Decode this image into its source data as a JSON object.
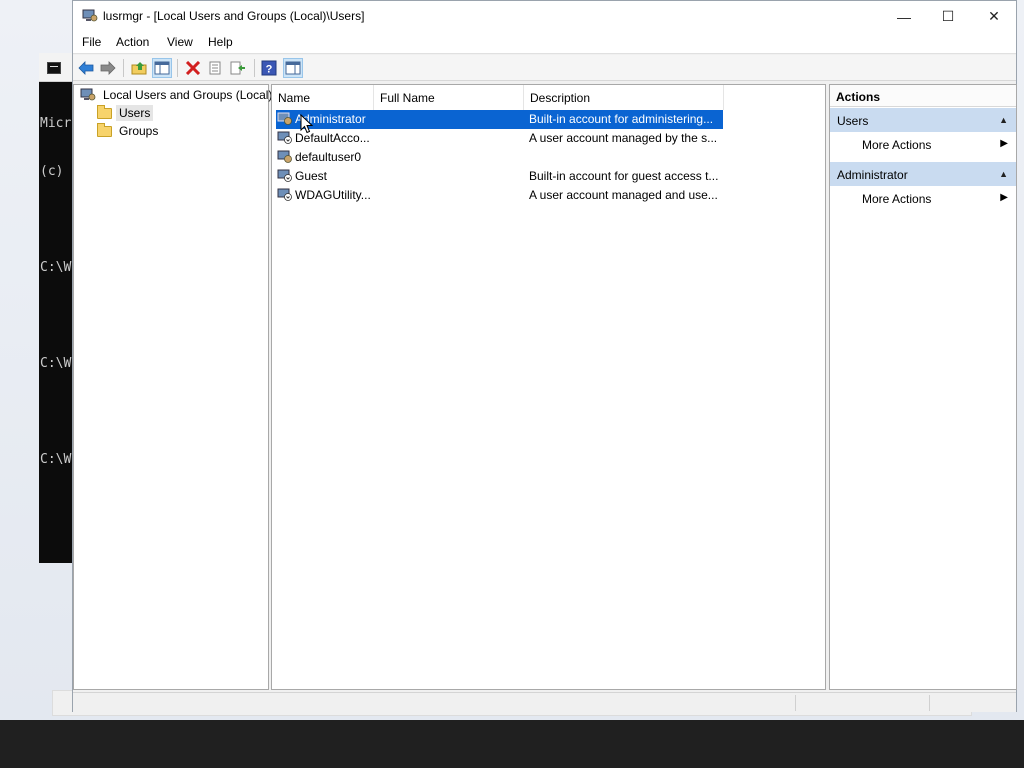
{
  "window": {
    "title": "lusrmgr - [Local Users and Groups (Local)\\Users]",
    "minimize_glyph": "—",
    "maximize_glyph": "☐",
    "close_glyph": "✕"
  },
  "menu": [
    "File",
    "Action",
    "View",
    "Help"
  ],
  "toolbar_icons": [
    "back-arrow-icon",
    "forward-arrow-icon",
    "up-folder-icon",
    "show-hide-tree-icon",
    "delete-icon",
    "properties-icon",
    "export-list-icon",
    "help-icon",
    "show-hide-action-pane-icon"
  ],
  "tree": {
    "root": "Local Users and Groups (Local)",
    "children": [
      {
        "label": "Users",
        "selected": true
      },
      {
        "label": "Groups",
        "selected": false
      }
    ]
  },
  "list": {
    "columns": [
      "Name",
      "Full Name",
      "Description"
    ],
    "rows": [
      {
        "name": "Administrator",
        "full_name": "",
        "description": "Built-in account for administering...",
        "selected": true
      },
      {
        "name": "DefaultAcco...",
        "full_name": "",
        "description": "A user account managed by the s...",
        "selected": false
      },
      {
        "name": "defaultuser0",
        "full_name": "",
        "description": "",
        "selected": false
      },
      {
        "name": "Guest",
        "full_name": "",
        "description": "Built-in account for guest access t...",
        "selected": false
      },
      {
        "name": "WDAGUtility...",
        "full_name": "",
        "description": "A user account managed and use...",
        "selected": false
      }
    ]
  },
  "actions": {
    "title": "Actions",
    "groups": [
      {
        "label": "Users",
        "items": [
          "More Actions"
        ]
      },
      {
        "label": "Administrator",
        "items": [
          "More Actions"
        ]
      }
    ]
  },
  "console_text": [
    "Micr",
    "(c)",
    "",
    "C:\\W",
    "",
    "C:\\W",
    "",
    "C:\\W"
  ],
  "colors": {
    "selection": "#0a64d2",
    "action_group": "#c9dbf0",
    "taskbar": "#202020"
  }
}
